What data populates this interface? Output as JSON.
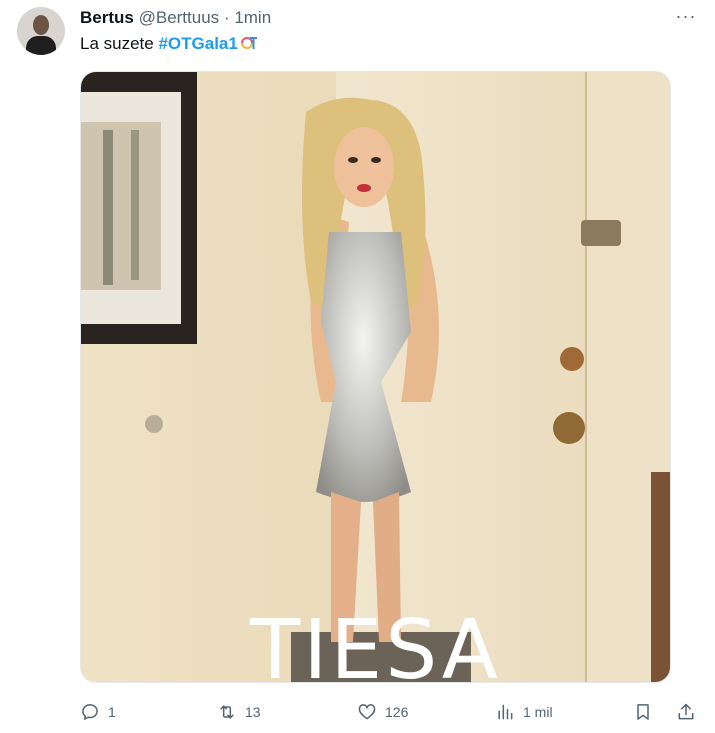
{
  "tweet": {
    "display_name": "Bertus",
    "handle": "@Berttuus",
    "separator": "·",
    "time": "1min",
    "more": "···",
    "text": "La suzete ",
    "hashtag": "#OTGala1",
    "media_caption": "TIESA"
  },
  "actions": {
    "reply_count": "1",
    "retweet_count": "13",
    "like_count": "126",
    "views_count": "1 mil"
  },
  "icons": {
    "reply": "reply-icon",
    "retweet": "retweet-icon",
    "like": "heart-icon",
    "views": "views-chart-icon",
    "bookmark": "bookmark-icon",
    "share": "share-icon",
    "more": "more-horizontal-icon"
  },
  "colors": {
    "accent": "#1d9bf0",
    "secondary_text": "#536471",
    "primary_text": "#0f1419"
  }
}
